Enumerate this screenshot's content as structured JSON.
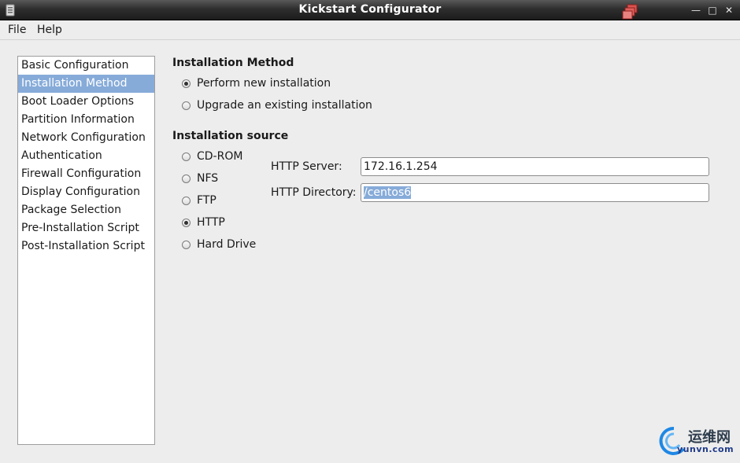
{
  "window": {
    "title": "Kickstart Configurator"
  },
  "menu": [
    {
      "label": "File"
    },
    {
      "label": "Help"
    }
  ],
  "sidebar": {
    "items": [
      {
        "label": "Basic Configuration",
        "selected": false
      },
      {
        "label": "Installation Method",
        "selected": true
      },
      {
        "label": "Boot Loader Options",
        "selected": false
      },
      {
        "label": "Partition Information",
        "selected": false
      },
      {
        "label": "Network Configuration",
        "selected": false
      },
      {
        "label": "Authentication",
        "selected": false
      },
      {
        "label": "Firewall Configuration",
        "selected": false
      },
      {
        "label": "Display Configuration",
        "selected": false
      },
      {
        "label": "Package Selection",
        "selected": false
      },
      {
        "label": "Pre-Installation Script",
        "selected": false
      },
      {
        "label": "Post-Installation Script",
        "selected": false
      }
    ]
  },
  "method": {
    "title": "Installation Method",
    "options": [
      {
        "label": "Perform new installation",
        "checked": true
      },
      {
        "label": "Upgrade an existing installation",
        "checked": false
      }
    ]
  },
  "source": {
    "title": "Installation source",
    "options": [
      {
        "label": "CD-ROM",
        "checked": false
      },
      {
        "label": "NFS",
        "checked": false
      },
      {
        "label": "FTP",
        "checked": false
      },
      {
        "label": "HTTP",
        "checked": true
      },
      {
        "label": "Hard Drive",
        "checked": false
      }
    ],
    "http_server": {
      "label": "HTTP Server:",
      "value": "172.16.1.254"
    },
    "http_directory": {
      "label": "HTTP Directory:",
      "value": "/centos6"
    }
  },
  "watermark": {
    "chinese": "运维网",
    "url": "yunvn.com"
  },
  "colors": {
    "selection": "#86abd9",
    "titlebar": "#2e2e2e"
  }
}
